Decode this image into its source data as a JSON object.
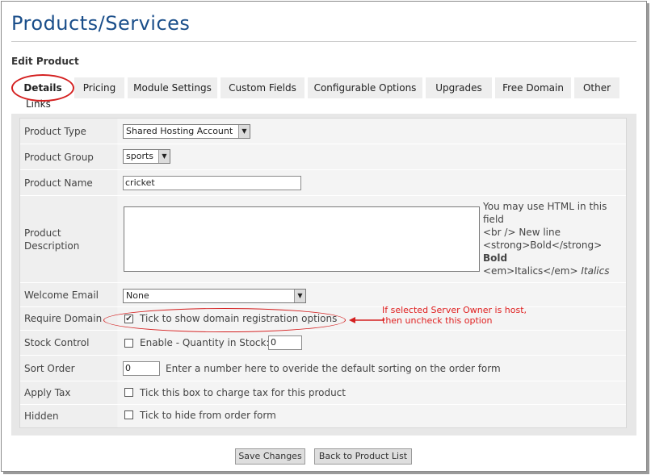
{
  "page": {
    "title": "Products/Services",
    "subtitle": "Edit Product"
  },
  "tabs": [
    {
      "label": "Details",
      "active": true
    },
    {
      "label": "Pricing"
    },
    {
      "label": "Module Settings"
    },
    {
      "label": "Custom Fields"
    },
    {
      "label": "Configurable Options"
    },
    {
      "label": "Upgrades"
    },
    {
      "label": "Free Domain"
    },
    {
      "label": "Other"
    }
  ],
  "tabs_wrap_label": "Links",
  "form": {
    "product_type": {
      "label": "Product Type",
      "value": "Shared Hosting Account"
    },
    "product_group": {
      "label": "Product Group",
      "value": "sports"
    },
    "product_name": {
      "label": "Product Name",
      "value": "cricket"
    },
    "product_description": {
      "label_line1": "Product",
      "label_line2": "Description",
      "value": "",
      "help_line1": "You may use HTML in this",
      "help_line2": "field",
      "help_line3": "<br /> New line",
      "help_line4": "<strong>Bold</strong>",
      "help_bold": "Bold",
      "help_line5": "<em>Italics</em>",
      "help_italic": "Italics"
    },
    "welcome_email": {
      "label": "Welcome Email",
      "value": "None"
    },
    "require_domain": {
      "label": "Require Domain",
      "checkbox_text": "Tick to show domain registration options",
      "checked": true
    },
    "stock_control": {
      "label": "Stock Control",
      "checkbox_text": "Enable - Quantity in Stock:",
      "checked": false,
      "quantity": "0"
    },
    "sort_order": {
      "label": "Sort Order",
      "value": "0",
      "help": "Enter a number here to overide the default sorting on the order form"
    },
    "apply_tax": {
      "label": "Apply Tax",
      "checkbox_text": "Tick this box to charge tax for this product",
      "checked": false
    },
    "hidden": {
      "label": "Hidden",
      "checkbox_text": "Tick to hide from order form",
      "checked": false
    }
  },
  "annotation": {
    "line1": "If selected Server Owner is host,",
    "line2": "then uncheck this option",
    "color": "#e02020"
  },
  "buttons": {
    "save": "Save Changes",
    "back": "Back to Product List"
  },
  "colors": {
    "title": "#1a4e8a",
    "highlight": "#d42020"
  }
}
